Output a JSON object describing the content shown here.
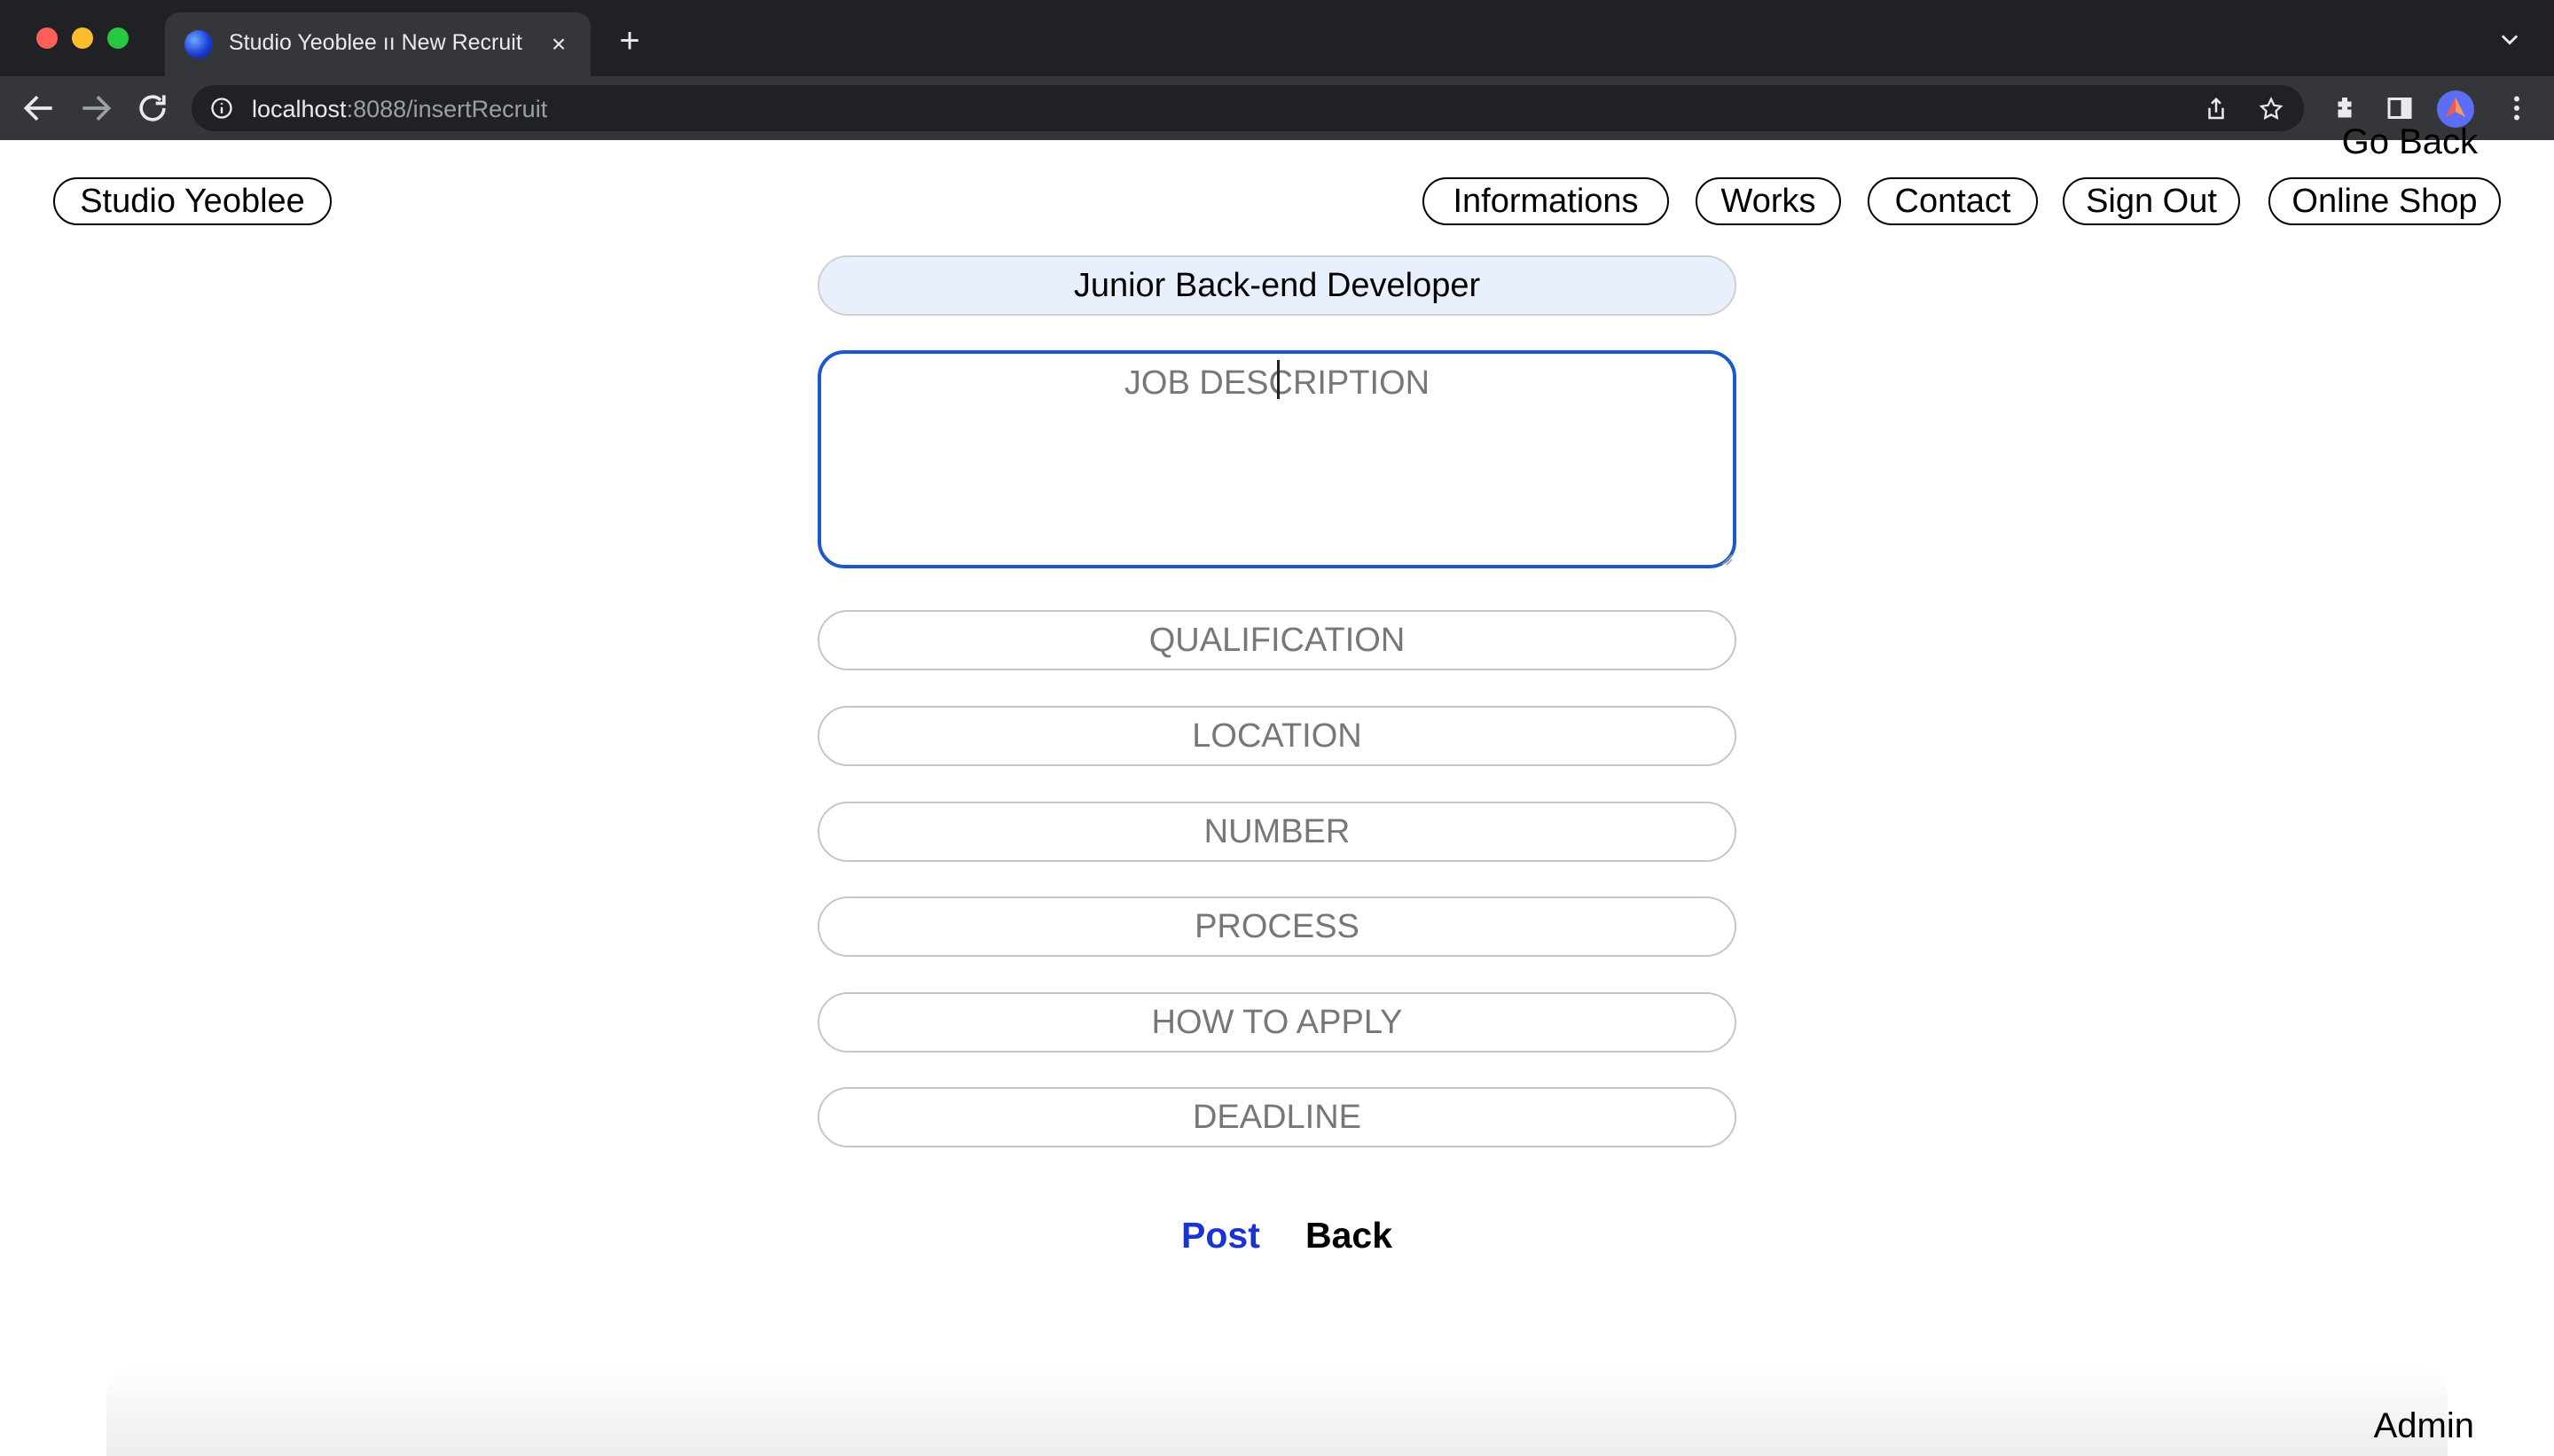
{
  "browser": {
    "tab_title": "Studio Yeoblee ıı New Recruit",
    "tab_close": "×",
    "new_tab": "+",
    "url_host": "localhost",
    "url_path": ":8088/insertRecruit"
  },
  "header": {
    "partial_link": "Go Back",
    "brand": "Studio Yeoblee",
    "nav": [
      "Informations",
      "Works",
      "Contact",
      "Sign Out",
      "Online Shop"
    ]
  },
  "form": {
    "title_value": "Junior Back-end Developer",
    "job_description_placeholder": "JOB DESCRIPTION",
    "qualification_placeholder": "QUALIFICATION",
    "location_placeholder": "LOCATION",
    "number_placeholder": "NUMBER",
    "process_placeholder": "PROCESS",
    "how_to_apply_placeholder": "HOW TO APPLY",
    "deadline_placeholder": "DEADLINE",
    "post_label": "Post",
    "back_label": "Back"
  },
  "footer": {
    "role": "Admin"
  },
  "colors": {
    "chrome_dark": "#202124",
    "chrome_toolbar": "#35363a",
    "focus_border": "#1a5bc9",
    "autofill_bg": "#e8f0fe",
    "post_blue": "#1a33d6"
  },
  "icons": [
    "back-arrow-icon",
    "forward-arrow-icon",
    "reload-icon",
    "info-icon",
    "share-icon",
    "star-icon",
    "extensions-icon",
    "side-panel-icon",
    "profile-avatar",
    "more-menu-icon",
    "tab-list-icon",
    "favicon-icon"
  ]
}
